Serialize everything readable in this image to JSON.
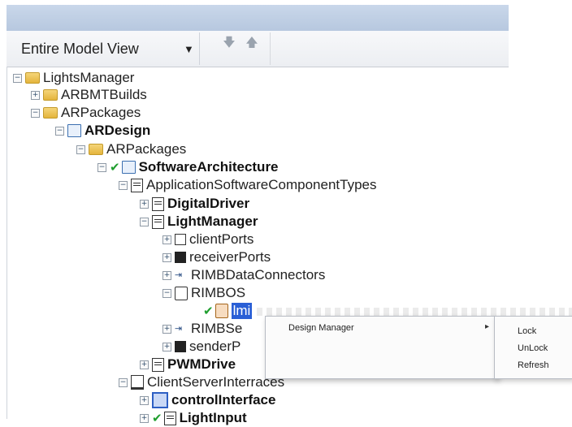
{
  "toolbar": {
    "view_label": "Entire Model View",
    "dropdown_glyph": "▼",
    "move_down_glyph": "🡇",
    "move_up_glyph": "🡅"
  },
  "tree": [
    {
      "label": "LightsManager",
      "icon": "folder-icon",
      "expander": "−"
    },
    {
      "label": "ARBMTBuilds",
      "icon": "folder-icon",
      "expander": "+"
    },
    {
      "label": "ARPackages",
      "icon": "folder-icon",
      "expander": "−"
    },
    {
      "label": "ARDesign",
      "icon": "package-icon",
      "expander": "−",
      "bold": true
    },
    {
      "label": "ARPackages",
      "icon": "folder-icon",
      "expander": "−"
    },
    {
      "label": "SoftwareArchitecture",
      "icon": "package-icon",
      "expander": "−",
      "bold": true,
      "check": "✔"
    },
    {
      "label": "ApplicationSoftwareComponentTypes",
      "icon": "document-icon",
      "expander": "−"
    },
    {
      "label": "DigitalDriver",
      "icon": "document-icon",
      "expander": "+",
      "bold": true
    },
    {
      "label": "LightManager",
      "icon": "document-icon",
      "expander": "−",
      "bold": true
    },
    {
      "label": "clientPorts",
      "icon": "port-icon",
      "expander": "+"
    },
    {
      "label": "receiverPorts",
      "icon": "receiver-port-icon",
      "expander": "+"
    },
    {
      "label": "RIMBDataConnectors",
      "icon": "connector-icon",
      "expander": "+"
    },
    {
      "label": "RIMBOS",
      "icon": "os-icon",
      "expander": "−"
    },
    {
      "label": "lmi",
      "icon": "implementation-icon",
      "check": "✔"
    },
    {
      "label": "RIMBSe",
      "icon": "connector-icon",
      "expander": "+"
    },
    {
      "label": "senderP",
      "icon": "sender-port-icon",
      "expander": "+"
    },
    {
      "label": "PWMDrive",
      "icon": "document-icon",
      "expander": "+",
      "bold": true
    },
    {
      "label": "ClientServerInterraces",
      "icon": "interface-icon",
      "expander": "−"
    },
    {
      "label": "controlInterface",
      "icon": "client-interface-icon",
      "expander": "+",
      "bold": true
    },
    {
      "label": "LightInput",
      "icon": "document-icon",
      "expander": "+",
      "bold": true,
      "check": "✔"
    }
  ],
  "context_menu": {
    "item_label": "Design Manager",
    "submenu_arrow": "▸",
    "submenu": [
      "Lock",
      "UnLock",
      "Refresh"
    ]
  }
}
